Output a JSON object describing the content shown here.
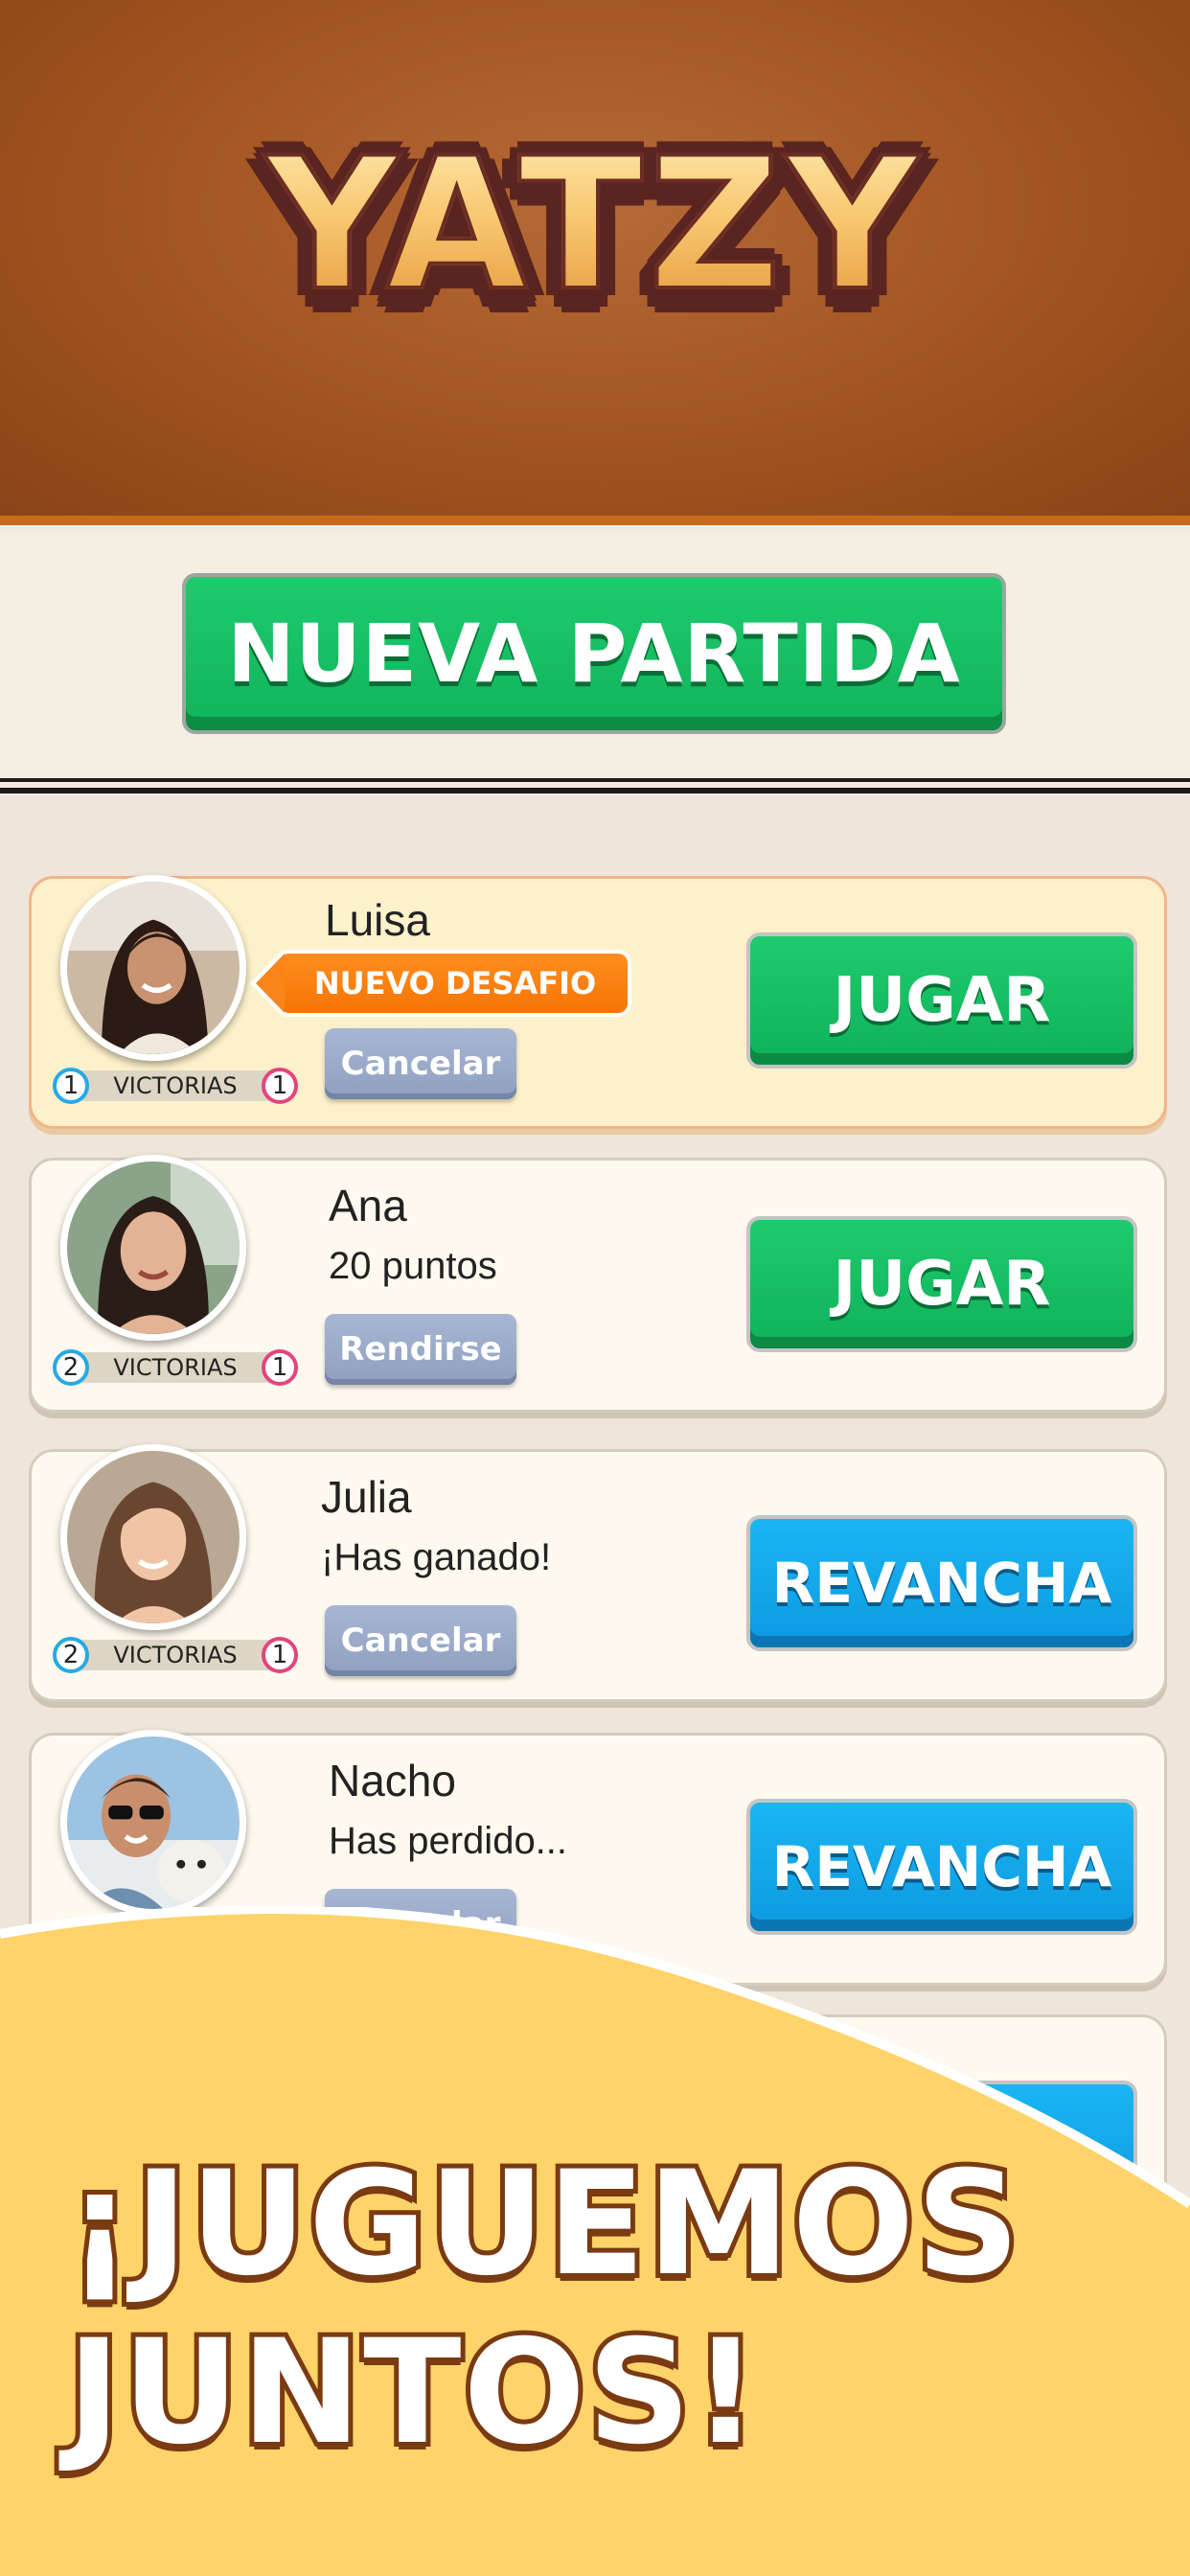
{
  "app": {
    "title": "YATZY"
  },
  "new_game": {
    "label": "NUEVA PARTIDA"
  },
  "wins_label": "VICTORIAS",
  "games": [
    {
      "name": "Luisa",
      "status": "",
      "tag": "NUEVO DESAFIO",
      "secondary_button": "Cancelar",
      "primary_button": "JUGAR",
      "my_wins": "1",
      "opp_wins": "1"
    },
    {
      "name": "Ana",
      "status": "20 puntos",
      "secondary_button": "Rendirse",
      "primary_button": "JUGAR",
      "my_wins": "2",
      "opp_wins": "1"
    },
    {
      "name": "Julia",
      "status": "¡Has ganado!",
      "secondary_button": "Cancelar",
      "primary_button": "REVANCHA",
      "my_wins": "2",
      "opp_wins": "1"
    },
    {
      "name": "Nacho",
      "status": "Has perdido...",
      "secondary_button": "Cancelar",
      "primary_button": "REVANCHA"
    }
  ],
  "promo": {
    "line1": "¡JUGUEMOS",
    "line2": "JUNTOS!"
  },
  "colors": {
    "header_brown": "#a1541f",
    "play_green": "#10b35a",
    "rematch_blue": "#0d99e0",
    "challenge_orange": "#f57505",
    "promo_yellow": "#fdd36a"
  }
}
